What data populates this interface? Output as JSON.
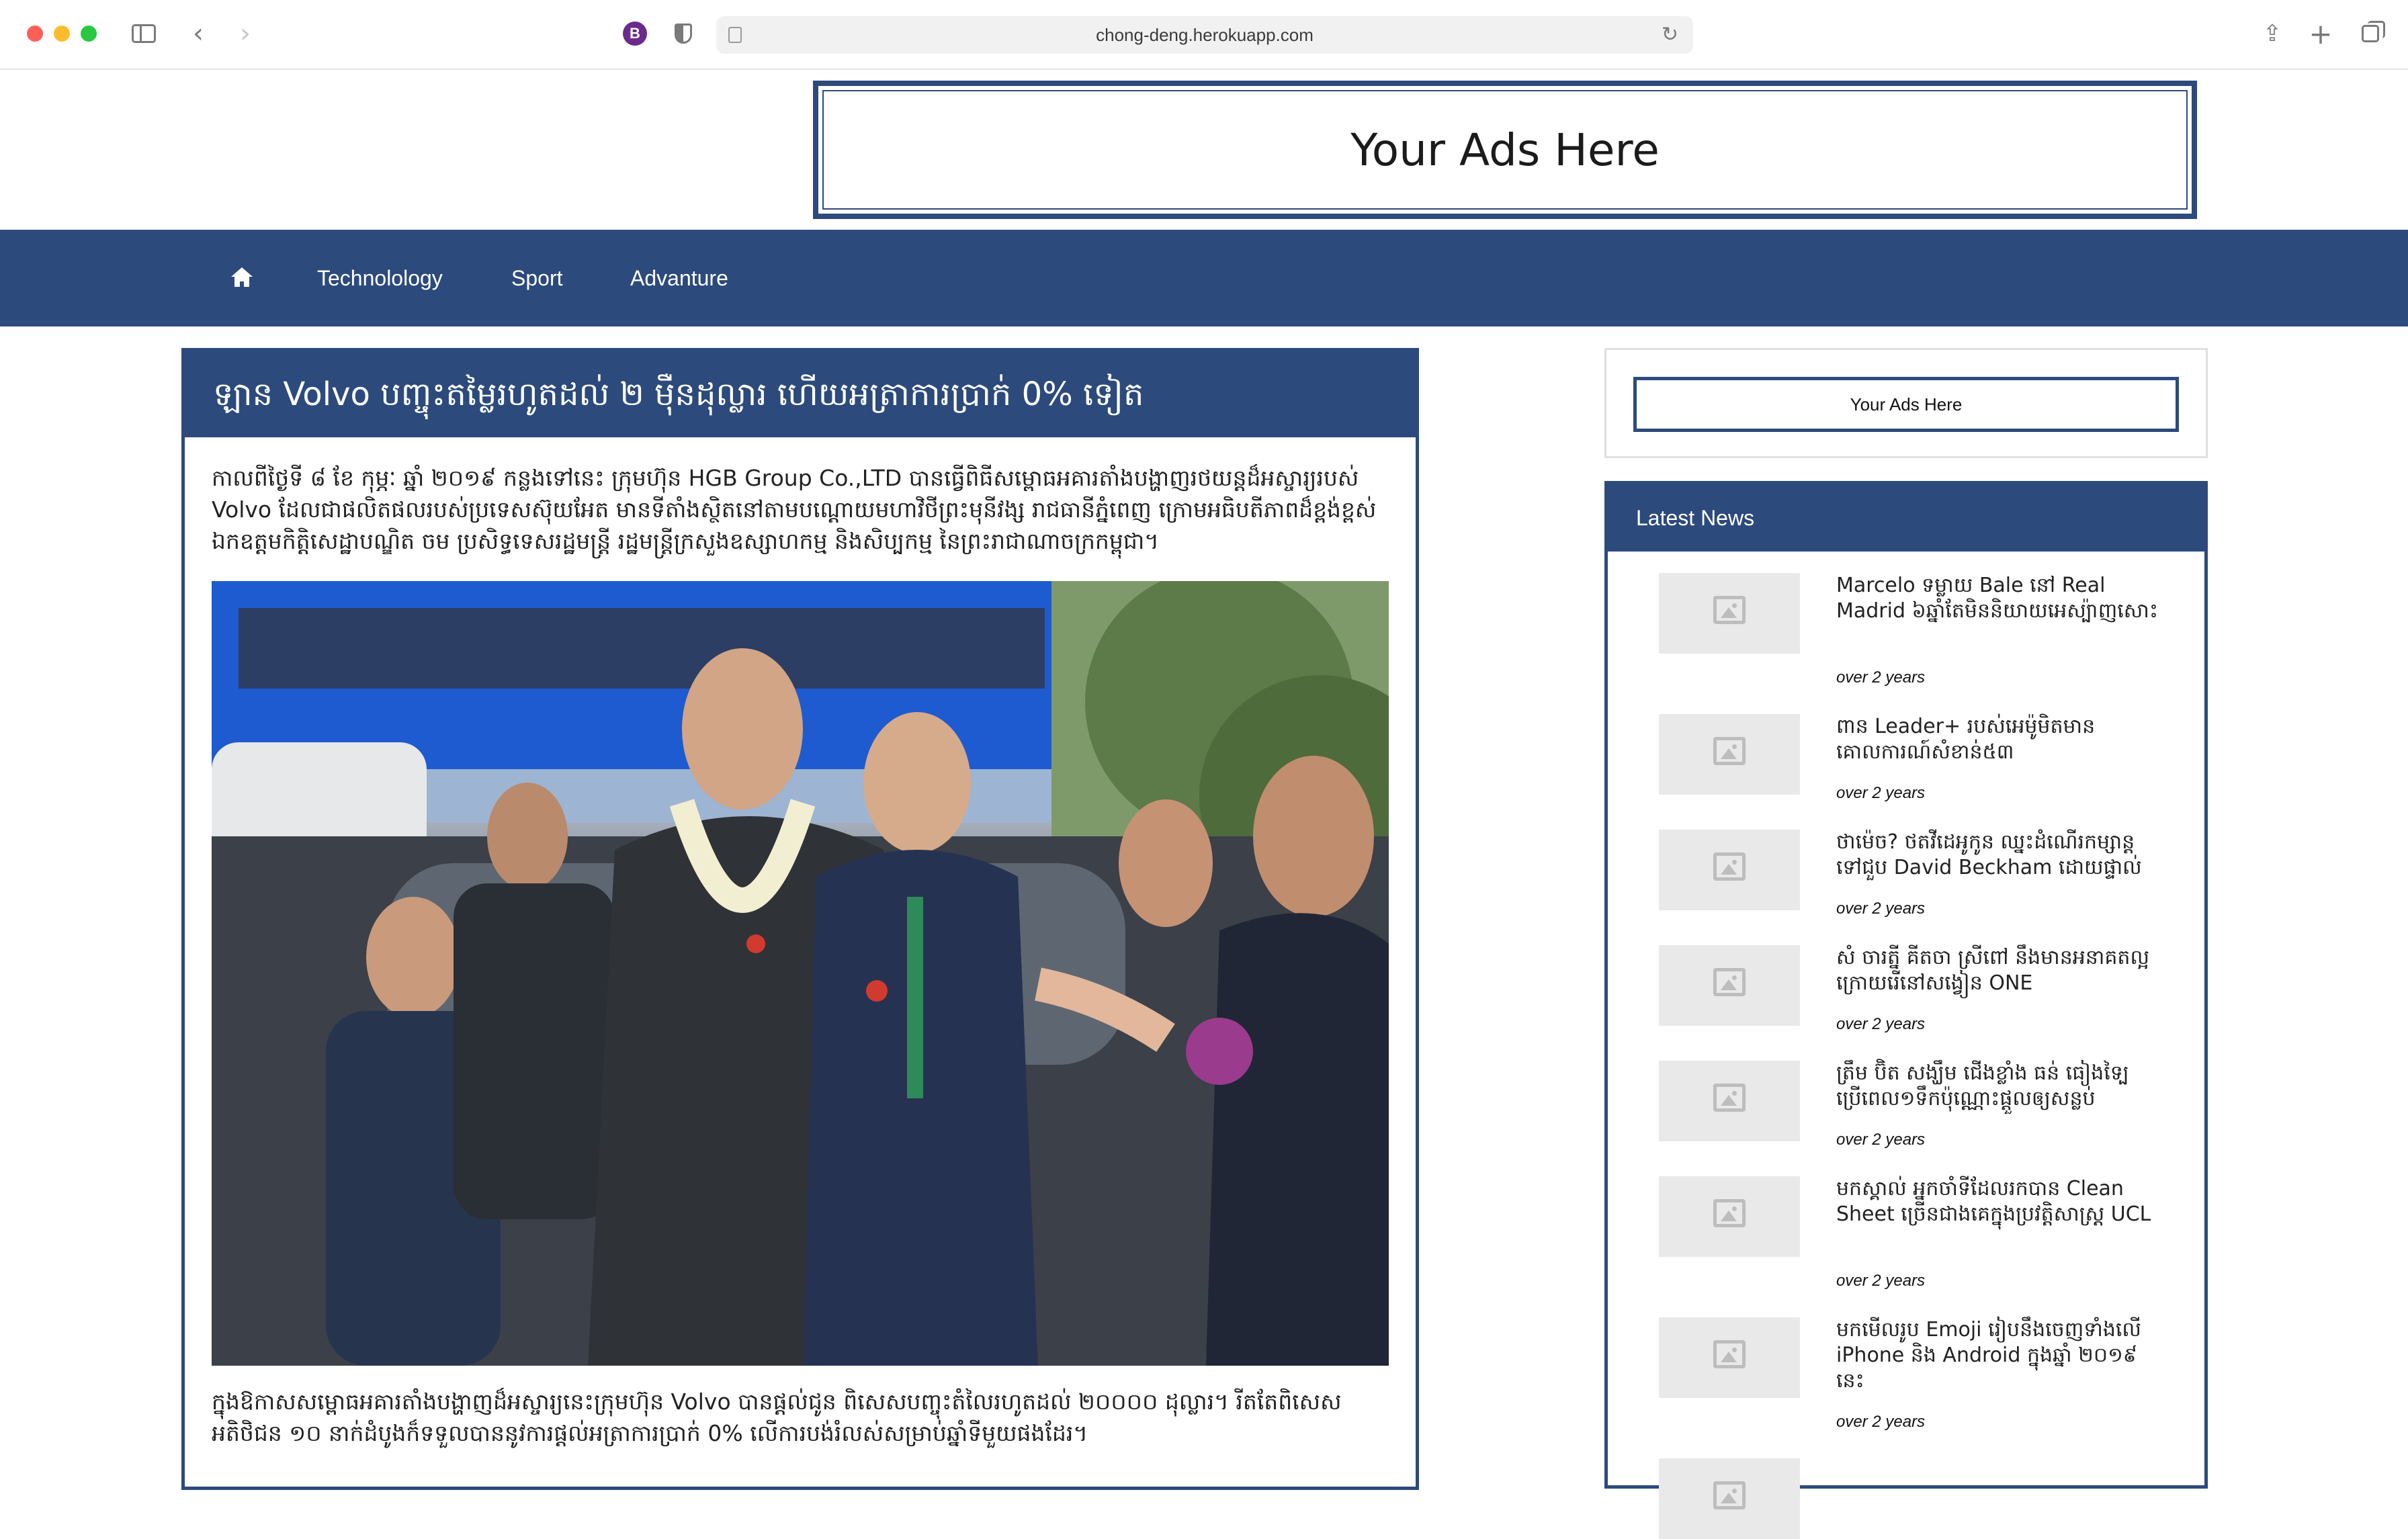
{
  "browser": {
    "url": "chong-deng.herokuapp.com",
    "extension_letter": "B"
  },
  "header_ad": {
    "label": "Your Ads Here"
  },
  "nav": {
    "home_icon": "home-icon",
    "items": [
      "Technolology",
      "Sport",
      "Advanture"
    ]
  },
  "article": {
    "title": "ឡាន Volvo បញ្ចុះតម្លៃរហូតដល់ ២ ម៉ឺនដុល្លារ ហើយអត្រាការប្រាក់ 0% ទៀត",
    "paragraph_1": "កាលពីថ្ងៃទី ៨ ខែ កុម្ភៈ ឆ្នាំ ២០១៩ កន្លងទៅនេះ ក្រុមហ៊ុន HGB Group Co.,LTD បានធ្វើពិធីសម្ពោធអគារតាំងបង្ហាញរថយន្តដ៏អស្ចារ្យរបស់ Volvo ដែលជាផលិតផលរបស់ប្រទេសស៊ុយអែត មានទីតាំងស្ថិតនៅតាមបណ្ដោយមហាវិថីព្រះមុនីវង្ស រាជធានីភ្នំពេញ ក្រោមអធិបតីភាពដ៏ខ្ពង់ខ្ពស់ ឯកឧត្តមកិត្តិសេដ្ឋាបណ្ឌិត ចម ប្រសិទ្ធទេសរដ្ឋមន្រ្តី រដ្ឋមន្រ្តីក្រសួងឧស្សាហកម្ម និងសិប្បកម្ម នៃព្រះរាជាណាចក្រកម្ពុជា។",
    "paragraph_2": "ក្នុងឱកាសសម្ពោធអគារតាំងបង្ហាញដ៏អស្ចារ្យនេះក្រុមហ៊ុន Volvo បានផ្ដល់ជូន ពិសេសបញ្ចុះតំលៃរហូតដល់ ២០០០០ ដុល្លារ។ រីតតែពិសេសអតិថិជន ១០ នាក់ដំបូងក៏ទទួលបាននូវការផ្ដល់អត្រាការប្រាក់ 0% លើការបង់រំលស់សម្រាប់ឆ្នាំទីមួយផងដែរ។"
  },
  "sidebar": {
    "ad_label": "Your Ads Here",
    "latest_title": "Latest News",
    "news": [
      {
        "title": "Marcelo ទម្លាយ Bale នៅ Real Madrid ៦ឆ្នាំតែមិននិយាយអេស្ប៉ាញសោះ",
        "time": "over 2 years"
      },
      {
        "title": "ពាន Leader+ របស់អេម៉ូមិតមានគោលការណ៍សំខាន់៥៣",
        "time": "over 2 years"
      },
      {
        "title": "ថាម៉េច? ថតវីដេអូកូន ឈ្នះដំណើរកម្សាន្តទៅជួប David Beckham ដោយផ្ទាល់",
        "time": "over 2 years"
      },
      {
        "title": "សំ ចារត្នី គីតចា ស្រីពៅ នឹងមានអនាគតល្អក្រោយរើនៅសង្វៀន ONE",
        "time": "over 2 years"
      },
      {
        "title": "ត្រឹម ប៊ិត សង្ឃឹម ជើងខ្លាំង ធន់ ធៀងទ្បៃ ប្រើពេល១ទឹកប៉ុណ្ណោះផ្ដួលឲ្យសន្លប់",
        "time": "over 2 years"
      },
      {
        "title": "មកស្គាល់ អ្នកចាំទីដែលរកបាន Clean Sheet ច្រើនជាងគេក្នុងប្រវត្តិសាស្រ្ត UCL",
        "time": "over 2 years"
      },
      {
        "title": "មកមើលរូប Emoji រៀបនឹងចេញទាំងលើ iPhone និង Android ក្នុងឆ្នាំ ២០១៩ នេះ",
        "time": "over 2 years"
      }
    ]
  }
}
